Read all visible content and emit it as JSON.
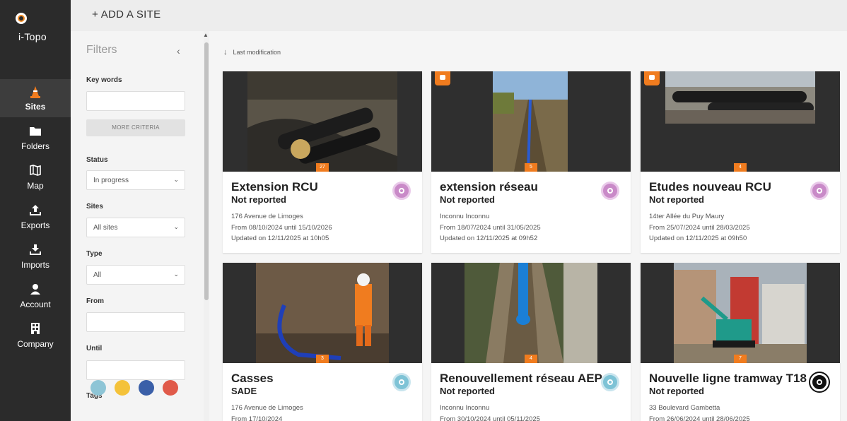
{
  "app": {
    "logo_text": "i-Topo"
  },
  "nav": [
    {
      "id": "sites",
      "label": "Sites",
      "icon": "cone-icon",
      "active": true
    },
    {
      "id": "folders",
      "label": "Folders",
      "icon": "folder-icon"
    },
    {
      "id": "map",
      "label": "Map",
      "icon": "map-icon"
    },
    {
      "id": "exports",
      "label": "Exports",
      "icon": "upload-icon"
    },
    {
      "id": "imports",
      "label": "Imports",
      "icon": "download-icon"
    },
    {
      "id": "account",
      "label": "Account",
      "icon": "user-icon"
    },
    {
      "id": "company",
      "label": "Company",
      "icon": "building-icon"
    }
  ],
  "topbar": {
    "add_site": "+ ADD A SITE"
  },
  "filters": {
    "title": "Filters",
    "keywords_label": "Key words",
    "keywords_value": "",
    "more_criteria": "MORE CRITERIA",
    "status_label": "Status",
    "status_value": "In progress",
    "sites_label": "Sites",
    "sites_value": "All sites",
    "type_label": "Type",
    "type_value": "All",
    "from_label": "From",
    "until_label": "Until",
    "tags_label": "Tags"
  },
  "sort": {
    "label": "Last modification"
  },
  "colors": {
    "accent": "#f07c1f",
    "nav_bg": "#2b2b2b"
  },
  "cards": [
    {
      "title": "Extension RCU",
      "subtitle": "Not reported",
      "address": "176 Avenue de Limoges",
      "period": "From 08/10/2024  until 15/10/2026",
      "updated": "Updated on 12/11/2025 at 10h05",
      "count": "27",
      "icon": "heat-network-icon"
    },
    {
      "title": "extension réseau",
      "subtitle": "Not reported",
      "address": "Inconnu Inconnu",
      "period": "From 18/07/2024  until 31/05/2025",
      "updated": "Updated on 12/11/2025 at 09h52",
      "count": "5",
      "icon": "heat-network-icon"
    },
    {
      "title": "Etudes nouveau RCU",
      "subtitle": "Not reported",
      "address": "14ter Allée du Puy Maury",
      "period": "From 25/07/2024  until 28/03/2025",
      "updated": "Updated on 12/11/2025 at 09h50",
      "count": "4",
      "icon": "heat-network-icon"
    },
    {
      "title": "Casses",
      "subtitle": "SADE",
      "address": "176 Avenue de Limoges",
      "period": "From 17/10/2024",
      "updated": "",
      "count": "3",
      "icon": "water-drop-icon"
    },
    {
      "title": "Renouvellement réseau AEP",
      "subtitle": "Not reported",
      "address": "Inconnu Inconnu",
      "period": "From 30/10/2024  until 05/11/2025",
      "updated": "",
      "count": "4",
      "icon": "water-drop-icon"
    },
    {
      "title": "Nouvelle ligne tramway T18",
      "subtitle": "Not reported",
      "address": "33 Boulevard Gambetta",
      "period": "From 26/06/2024  until 28/06/2025",
      "updated": "",
      "count": "7",
      "icon": "location-pin-icon"
    }
  ]
}
